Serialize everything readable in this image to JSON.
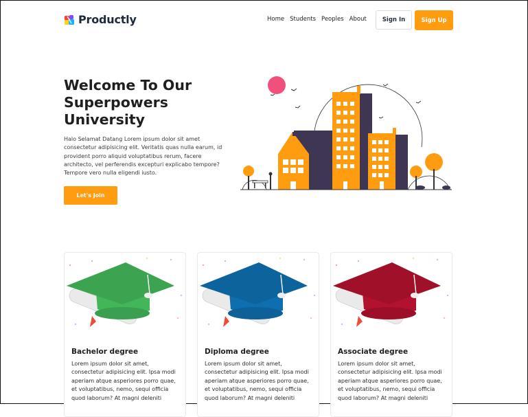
{
  "brand": {
    "name": "Productly"
  },
  "nav": {
    "items": [
      "Home",
      "Students",
      "Peoples",
      "About"
    ]
  },
  "auth": {
    "sign_in": "Sign In",
    "sign_up": "Sign Up"
  },
  "hero": {
    "title": "Welcome To Our Superpowers University",
    "description": "Halo Selamat Datang Lorem ipsum dolor sit amet consectetur adipisicing elit. Veritatis quas nulla earum, id provident porro aliquid voluptatibus rerum, facere architecto, vel perferendis excepturi explicabo tempore? Tempore vero nulla eligendi iusto.",
    "cta": "Let's Join"
  },
  "cards": [
    {
      "title": "Bachelor degree",
      "text": "Lorem ipsum dolor sit amet, consectetur adipisicing elit. Ipsa modi aperiam atque asperiores porro quae, et voluptatibus, nemo, sequi officia quod laborum? At magni deleniti",
      "cap_color": "#43b65a"
    },
    {
      "title": "Diploma degree",
      "text": "Lorem ipsum dolor sit amet, consectetur adipisicing elit. Ipsa modi aperiam atque asperiores porro quae, et voluptatibus, nemo, sequi officia quod laborum? At magni deleniti",
      "cap_color": "#0f6fae"
    },
    {
      "title": "Associate degree",
      "text": "Lorem ipsum dolor sit amet, consectetur adipisicing elit. Ipsa modi aperiam atque asperiores porro quae, et voluptatibus, nemo, sequi officia quod laborum? At magni deleniti",
      "cap_color": "#b3122e"
    }
  ],
  "colors": {
    "accent": "#ff9c0f",
    "building_dark": "#3f3653",
    "sun": "#f2507c"
  },
  "icons": {
    "logo": "productly-logo-icon",
    "illustration": "city-illustration",
    "card_image": "graduation-cap-icon"
  }
}
